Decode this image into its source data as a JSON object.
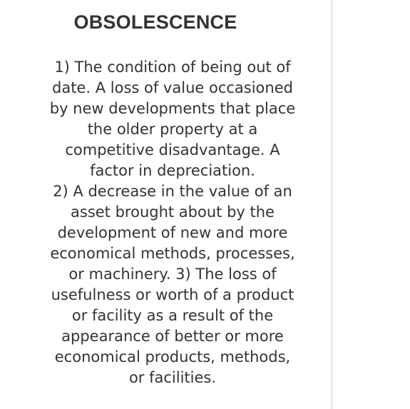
{
  "glossary_card": {
    "term": "OBSOLESCENCE",
    "definition": "1) The condition of being out of\ndate. A loss of value occasioned\nby new developments that place\nthe older property at a\ncompetitive disadvantage. A\nfactor in depreciation.\n2) A decrease in the value of an\nasset brought about by the\ndevelopment of new and more\neconomical methods, processes,\nor machinery. 3) The loss of\nusefulness or worth of a product\nor facility as a result of the\nappearance of better or more\neconomical products, methods,\nor facilities."
  }
}
